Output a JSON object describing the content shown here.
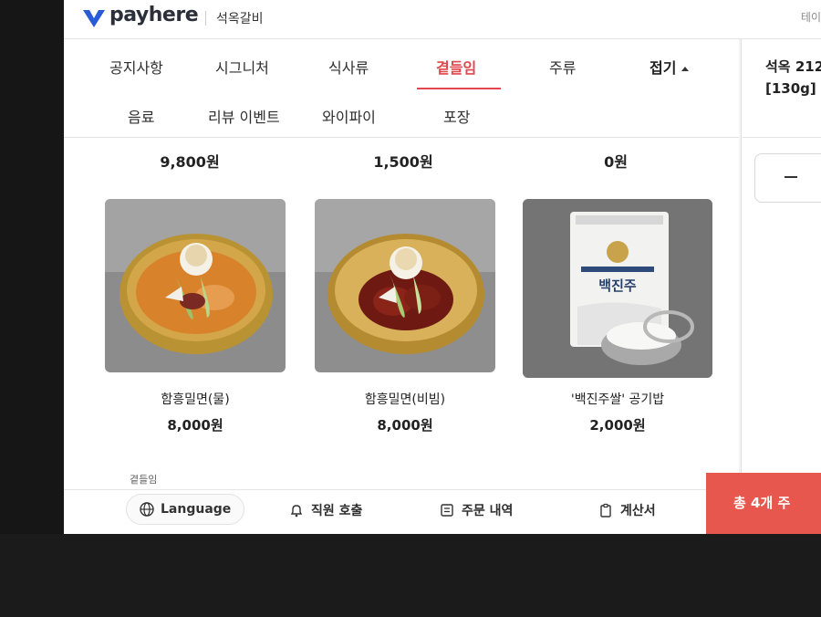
{
  "header": {
    "logo_text": "payhere",
    "store_name": "석옥갈비",
    "right_text": "테이"
  },
  "tabs": {
    "row1": [
      "공지사항",
      "시그니처",
      "식사류",
      "곁들임",
      "주류"
    ],
    "collapse_label": "접기",
    "row2": [
      "음료",
      "리뷰 이벤트",
      "와이파이",
      "포장"
    ],
    "active": "곁들임"
  },
  "top_prices": [
    "9,800원",
    "1,500원",
    "0원"
  ],
  "products": [
    {
      "name": "함흥밀면(물)",
      "price": "8,000원",
      "icon": "cold-noodle-broth-image"
    },
    {
      "name": "함흥밀면(비빔)",
      "price": "8,000원",
      "icon": "spicy-noodle-image"
    },
    {
      "name": "'백진주쌀' 공기밥",
      "price": "2,000원",
      "icon": "rice-bag-image"
    }
  ],
  "package_label": "백진주",
  "category_footer": "곁들임",
  "bottom_bar": {
    "language": "Language",
    "call_staff": "직원 호출",
    "order_history": "주문 내역",
    "bill": "계산서"
  },
  "right_pane": {
    "item_line1": "석옥 212",
    "item_line2": "[130g]",
    "order_button": "총 4개 주"
  },
  "colors": {
    "accent": "#e0474c",
    "order_button": "#e8574e",
    "logo": "#2a5bd7"
  }
}
